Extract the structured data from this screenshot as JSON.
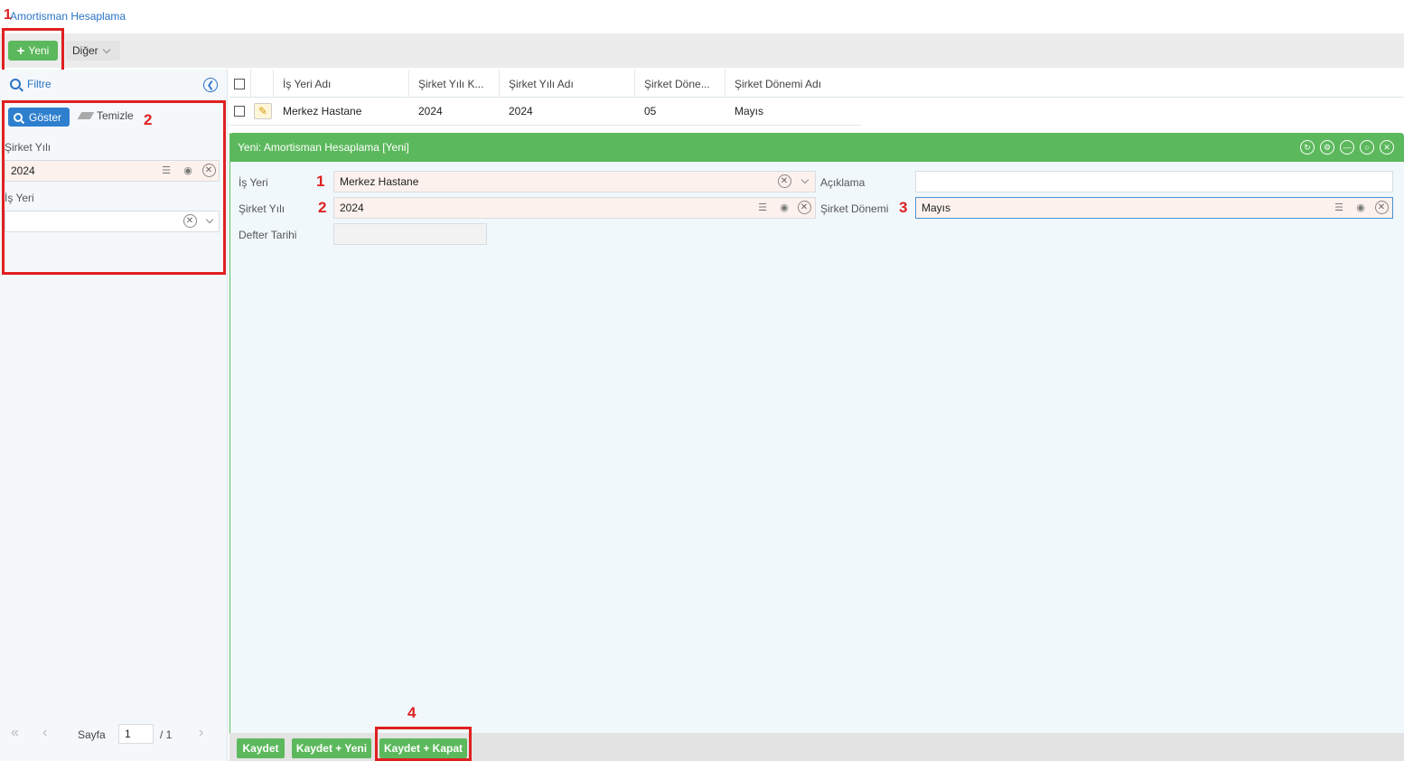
{
  "breadcrumb": "Amortisman Hesaplama",
  "toolbar": {
    "new_label": "Yeni",
    "other_label": "Diğer"
  },
  "filter": {
    "title": "Filtre",
    "show_label": "Göster",
    "clear_label": "Temizle",
    "company_year_label": "Şirket Yılı",
    "company_year_value": "2024",
    "workplace_label": "İş Yeri",
    "workplace_value": ""
  },
  "grid": {
    "headers": [
      "İş Yeri Adı",
      "Şirket Yılı K...",
      "Şirket Yılı Adı",
      "Şirket Döne...",
      "Şirket Dönemi Adı"
    ],
    "rows": [
      {
        "workplace": "Merkez Hastane",
        "year_code": "2024",
        "year_name": "2024",
        "period_code": "05",
        "period_name": "Mayıs"
      }
    ]
  },
  "modal": {
    "title": "Yeni: Amortisman Hesaplama [Yeni]",
    "workplace_label": "İş Yeri",
    "workplace_value": "Merkez Hastane",
    "company_year_label": "Şirket Yılı",
    "company_year_value": "2024",
    "ledger_date_label": "Defter Tarihi",
    "ledger_date_value": "",
    "description_label": "Açıklama",
    "description_value": "",
    "period_label": "Şirket Dönemi",
    "period_value": "Mayıs",
    "save_label": "Kaydet",
    "save_new_label": "Kaydet + Yeni",
    "save_close_label": "Kaydet + Kapat"
  },
  "pager": {
    "page_label": "Sayfa",
    "page_value": "1",
    "total": "/ 1"
  },
  "annotations": {
    "n1": "1",
    "n2": "2",
    "n3": "3",
    "n4": "4"
  },
  "colors": {
    "accent_green": "#5cb85c",
    "accent_blue": "#2f7fcf",
    "annotation_red": "#e02020",
    "required_bg": "#fcf1ec"
  }
}
